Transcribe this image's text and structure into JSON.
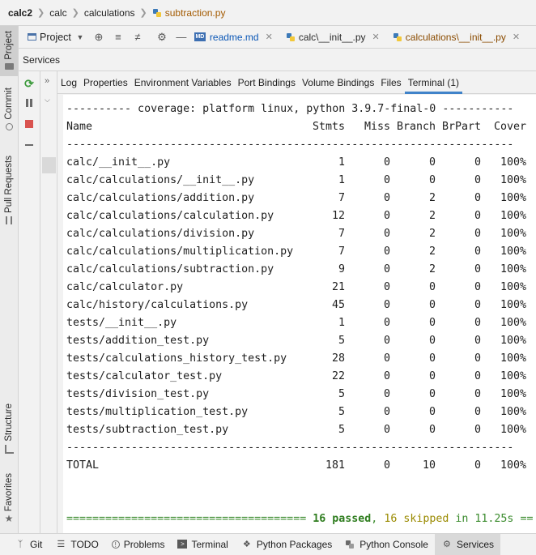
{
  "breadcrumb": {
    "items": [
      "calc2",
      "calc",
      "calculations",
      "subtraction.py"
    ]
  },
  "left_stripe": {
    "project": "Project",
    "commit": "Commit",
    "pull_requests": "Pull Requests",
    "structure": "Structure",
    "favorites": "Favorites"
  },
  "toolbar": {
    "project_label": "Project",
    "tabs": [
      {
        "label": "readme.md",
        "icon": "markdown-icon"
      },
      {
        "label": "calc\\__init__.py",
        "icon": "python-icon"
      },
      {
        "label": "calculations\\__init__.py",
        "icon": "python-icon"
      }
    ]
  },
  "services": {
    "title": "Services"
  },
  "detail_tabs": [
    "Log",
    "Properties",
    "Environment Variables",
    "Port Bindings",
    "Volume Bindings",
    "Files",
    "Terminal (1)"
  ],
  "terminal": {
    "header": "---------- coverage: platform linux, python 3.9.7-final-0 -----------",
    "columns": [
      "Name",
      "Stmts",
      "Miss",
      "Branch",
      "BrPart",
      "Cover"
    ],
    "separator": "---------------------------------------------------------------------",
    "rows": [
      [
        "calc/__init__.py",
        "1",
        "0",
        "0",
        "0",
        "100%"
      ],
      [
        "calc/calculations/__init__.py",
        "1",
        "0",
        "0",
        "0",
        "100%"
      ],
      [
        "calc/calculations/addition.py",
        "7",
        "0",
        "2",
        "0",
        "100%"
      ],
      [
        "calc/calculations/calculation.py",
        "12",
        "0",
        "2",
        "0",
        "100%"
      ],
      [
        "calc/calculations/division.py",
        "7",
        "0",
        "2",
        "0",
        "100%"
      ],
      [
        "calc/calculations/multiplication.py",
        "7",
        "0",
        "2",
        "0",
        "100%"
      ],
      [
        "calc/calculations/subtraction.py",
        "9",
        "0",
        "2",
        "0",
        "100%"
      ],
      [
        "calc/calculator.py",
        "21",
        "0",
        "0",
        "0",
        "100%"
      ],
      [
        "calc/history/calculations.py",
        "45",
        "0",
        "0",
        "0",
        "100%"
      ],
      [
        "tests/__init__.py",
        "1",
        "0",
        "0",
        "0",
        "100%"
      ],
      [
        "tests/addition_test.py",
        "5",
        "0",
        "0",
        "0",
        "100%"
      ],
      [
        "tests/calculations_history_test.py",
        "28",
        "0",
        "0",
        "0",
        "100%"
      ],
      [
        "tests/calculator_test.py",
        "22",
        "0",
        "0",
        "0",
        "100%"
      ],
      [
        "tests/division_test.py",
        "5",
        "0",
        "0",
        "0",
        "100%"
      ],
      [
        "tests/multiplication_test.py",
        "5",
        "0",
        "0",
        "0",
        "100%"
      ],
      [
        "tests/subtraction_test.py",
        "5",
        "0",
        "0",
        "0",
        "100%"
      ]
    ],
    "total": [
      "TOTAL",
      "181",
      "0",
      "10",
      "0",
      "100%"
    ],
    "summary_rule": "=====================================",
    "summary_passed": "16 passed",
    "summary_sep": ",",
    "summary_skipped": "16 skipped",
    "summary_time": "in 11.25s",
    "summary_tail": "=="
  },
  "bottom_bar": {
    "tabs": [
      {
        "label": "Git",
        "icon": "git-icon"
      },
      {
        "label": "TODO",
        "icon": "todo-icon"
      },
      {
        "label": "Problems",
        "icon": "problems-icon"
      },
      {
        "label": "Terminal",
        "icon": "terminal-icon"
      },
      {
        "label": "Python Packages",
        "icon": "packages-icon"
      },
      {
        "label": "Python Console",
        "icon": "python-console-icon"
      },
      {
        "label": "Services",
        "icon": "services-icon"
      }
    ]
  },
  "colors": {
    "passed": "#2f7d1f",
    "skipped": "#9a8a00",
    "summary_rule": "#3c8c2f",
    "active_tab_underline": "#4083c9"
  }
}
